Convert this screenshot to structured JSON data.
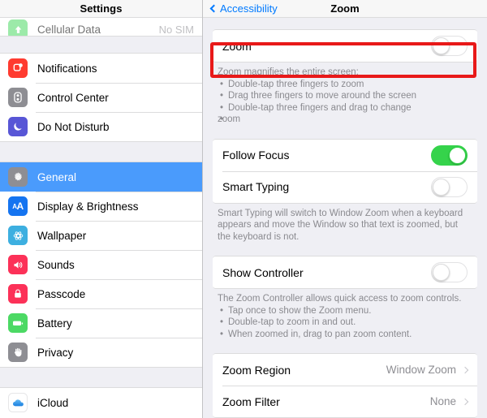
{
  "sidebar": {
    "title": "Settings",
    "groups": [
      {
        "items": [
          {
            "label": "Cellular Data",
            "value": "No SIM",
            "icon": "cellular-data-icon",
            "color": "#4cd964",
            "clipped": true
          }
        ]
      },
      {
        "items": [
          {
            "label": "Notifications",
            "value": "",
            "icon": "notifications-icon",
            "color": "#ff3b30"
          },
          {
            "label": "Control Center",
            "value": "",
            "icon": "control-center-icon",
            "color": "#8e8e93"
          },
          {
            "label": "Do Not Disturb",
            "value": "",
            "icon": "do-not-disturb-icon",
            "color": "#5856d6"
          }
        ]
      },
      {
        "items": [
          {
            "label": "General",
            "value": "",
            "icon": "gear-icon",
            "color": "#8e8e93",
            "selected": true
          },
          {
            "label": "Display & Brightness",
            "value": "",
            "icon": "display-brightness-icon",
            "color": "#1574f0"
          },
          {
            "label": "Wallpaper",
            "value": "",
            "icon": "wallpaper-icon",
            "color": "#3dafe0"
          },
          {
            "label": "Sounds",
            "value": "",
            "icon": "sounds-icon",
            "color": "#fc3158"
          },
          {
            "label": "Passcode",
            "value": "",
            "icon": "passcode-lock-icon",
            "color": "#fc3158"
          },
          {
            "label": "Battery",
            "value": "",
            "icon": "battery-icon",
            "color": "#4cd964"
          },
          {
            "label": "Privacy",
            "value": "",
            "icon": "privacy-hand-icon",
            "color": "#8e8e93"
          }
        ]
      },
      {
        "items": [
          {
            "label": "iCloud",
            "value": "",
            "icon": "icloud-icon",
            "color": "#ffffff"
          }
        ]
      }
    ]
  },
  "detail": {
    "back_label": "Accessibility",
    "title": "Zoom",
    "zoom_row": {
      "label": "Zoom",
      "toggle_state": "off"
    },
    "zoom_note": {
      "heading": "Zoom magnifies the entire screen:",
      "bullets": [
        "Double-tap three fingers to zoom",
        "Drag three fingers to move around the screen",
        "Double-tap three fingers and drag to change"
      ],
      "trailing": "zoom"
    },
    "focus_group": [
      {
        "label": "Follow Focus",
        "toggle_state": "on"
      },
      {
        "label": "Smart Typing",
        "toggle_state": "off"
      }
    ],
    "smart_typing_note": "Smart Typing will switch to Window Zoom when a keyboard appears and move the Window so that text is zoomed, but the keyboard is not.",
    "controller_group": [
      {
        "label": "Show Controller",
        "toggle_state": "off"
      }
    ],
    "controller_note": {
      "heading": "The Zoom Controller allows quick access to zoom controls.",
      "bullets": [
        "Tap once to show the Zoom menu.",
        "Double-tap to zoom in and out.",
        "When zoomed in, drag to pan zoom content."
      ]
    },
    "options_group": [
      {
        "label": "Zoom Region",
        "value": "Window Zoom"
      },
      {
        "label": "Zoom Filter",
        "value": "None"
      }
    ]
  },
  "annotation": {
    "highlight_color": "#e81919",
    "target": "zoom-toggle-row"
  }
}
